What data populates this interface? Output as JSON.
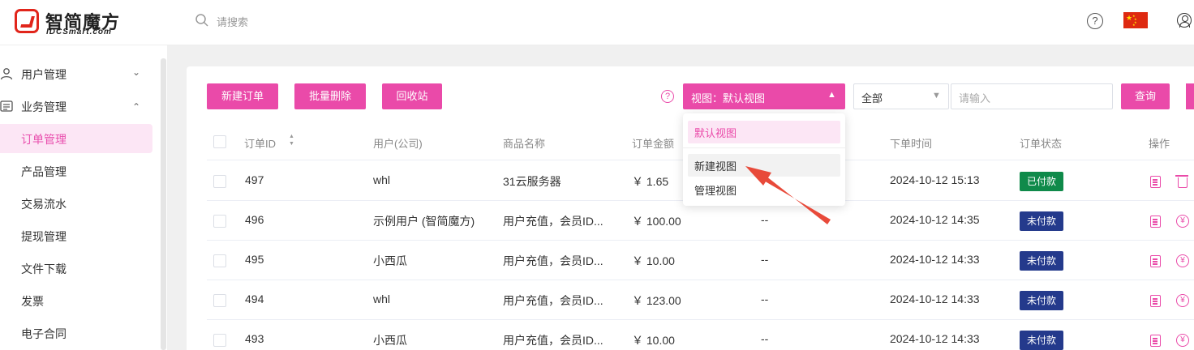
{
  "header": {
    "logo_cn": "智简魔方",
    "logo_en": "IDCSmart.com",
    "search_placeholder": "请搜索",
    "help": "?"
  },
  "sidebar": {
    "groups": [
      {
        "label": "用户管理",
        "icon": "user-icon",
        "expanded": false
      },
      {
        "label": "业务管理",
        "icon": "list-icon",
        "expanded": true
      }
    ],
    "items": [
      {
        "label": "订单管理",
        "active": true
      },
      {
        "label": "产品管理"
      },
      {
        "label": "交易流水"
      },
      {
        "label": "提现管理"
      },
      {
        "label": "文件下载"
      },
      {
        "label": "发票"
      },
      {
        "label": "电子合同"
      }
    ]
  },
  "toolbar": {
    "new_order": "新建订单",
    "batch_delete": "批量删除",
    "recycle_bin": "回收站",
    "view_select": "视图：默认视图",
    "status_select": "全部",
    "keyword_placeholder": "请输入",
    "query": "查询"
  },
  "view_dropdown": {
    "items": [
      "默认视图",
      "新建视图",
      "管理视图"
    ],
    "selected": "默认视图",
    "hovered": "新建视图"
  },
  "table": {
    "headers": {
      "order_id": "订单ID",
      "user": "用户(公司)",
      "product": "商品名称",
      "amount": "订单金额",
      "time": "下单时间",
      "status": "订单状态",
      "actions": "操作"
    },
    "rows": [
      {
        "id": "497",
        "user": "whl",
        "product": "31云服务器",
        "amount": "￥ 1.65",
        "col5": "",
        "time": "2024-10-12 15:13",
        "status": "已付款"
      },
      {
        "id": "496",
        "user": "示例用户 (智简魔方)",
        "product": "用户充值，会员ID...",
        "amount": "￥ 100.00",
        "col5": "--",
        "time": "2024-10-12 14:35",
        "status": "未付款"
      },
      {
        "id": "495",
        "user": "小西瓜",
        "product": "用户充值，会员ID...",
        "amount": "￥ 10.00",
        "col5": "--",
        "time": "2024-10-12 14:33",
        "status": "未付款"
      },
      {
        "id": "494",
        "user": "whl",
        "product": "用户充值，会员ID...",
        "amount": "￥ 123.00",
        "col5": "--",
        "time": "2024-10-12 14:33",
        "status": "未付款"
      },
      {
        "id": "493",
        "user": "小西瓜",
        "product": "用户充值，会员ID...",
        "amount": "￥ 10.00",
        "col5": "--",
        "time": "2024-10-12 14:33",
        "status": "未付款"
      }
    ]
  },
  "colors": {
    "accent": "#ea4aa9",
    "paid": "#0f8a4a",
    "unpaid": "#243a8c",
    "annotation_arrow": "#e84a3a"
  }
}
